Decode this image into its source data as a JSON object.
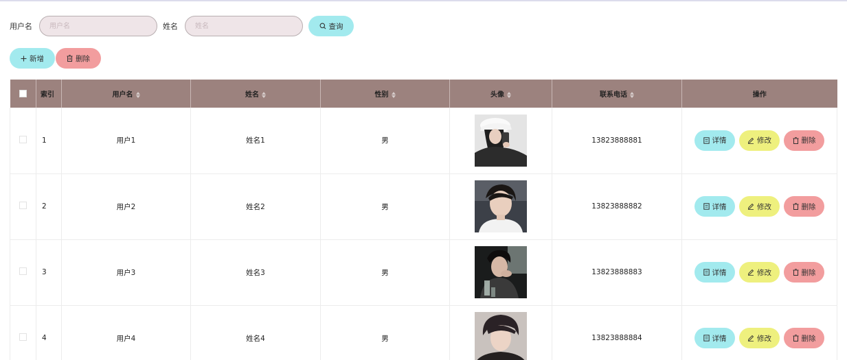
{
  "search": {
    "username_label": "用户名",
    "username_placeholder": "用户名",
    "name_label": "姓名",
    "name_placeholder": "姓名",
    "query_button": "查询"
  },
  "actions": {
    "add_button": "新增",
    "delete_button": "删除"
  },
  "table": {
    "headers": {
      "index": "索引",
      "username": "用户名",
      "name": "姓名",
      "gender": "性别",
      "avatar": "头像",
      "phone": "联系电话",
      "operations": "操作"
    },
    "row_buttons": {
      "detail": "详情",
      "edit": "修改",
      "delete": "删除"
    },
    "rows": [
      {
        "index": "1",
        "username": "用户1",
        "name": "姓名1",
        "gender": "男",
        "phone": "13823888881"
      },
      {
        "index": "2",
        "username": "用户2",
        "name": "姓名2",
        "gender": "男",
        "phone": "13823888882"
      },
      {
        "index": "3",
        "username": "用户3",
        "name": "姓名3",
        "gender": "男",
        "phone": "13823888883"
      },
      {
        "index": "4",
        "username": "用户4",
        "name": "姓名4",
        "gender": "男",
        "phone": "13823888884"
      }
    ]
  },
  "colors": {
    "header_bg": "#9c827e",
    "cyan_button": "#a2eaee",
    "yellow_button": "#eef07e",
    "red_button": "#f29d9e",
    "input_bg": "#efe5e8"
  }
}
